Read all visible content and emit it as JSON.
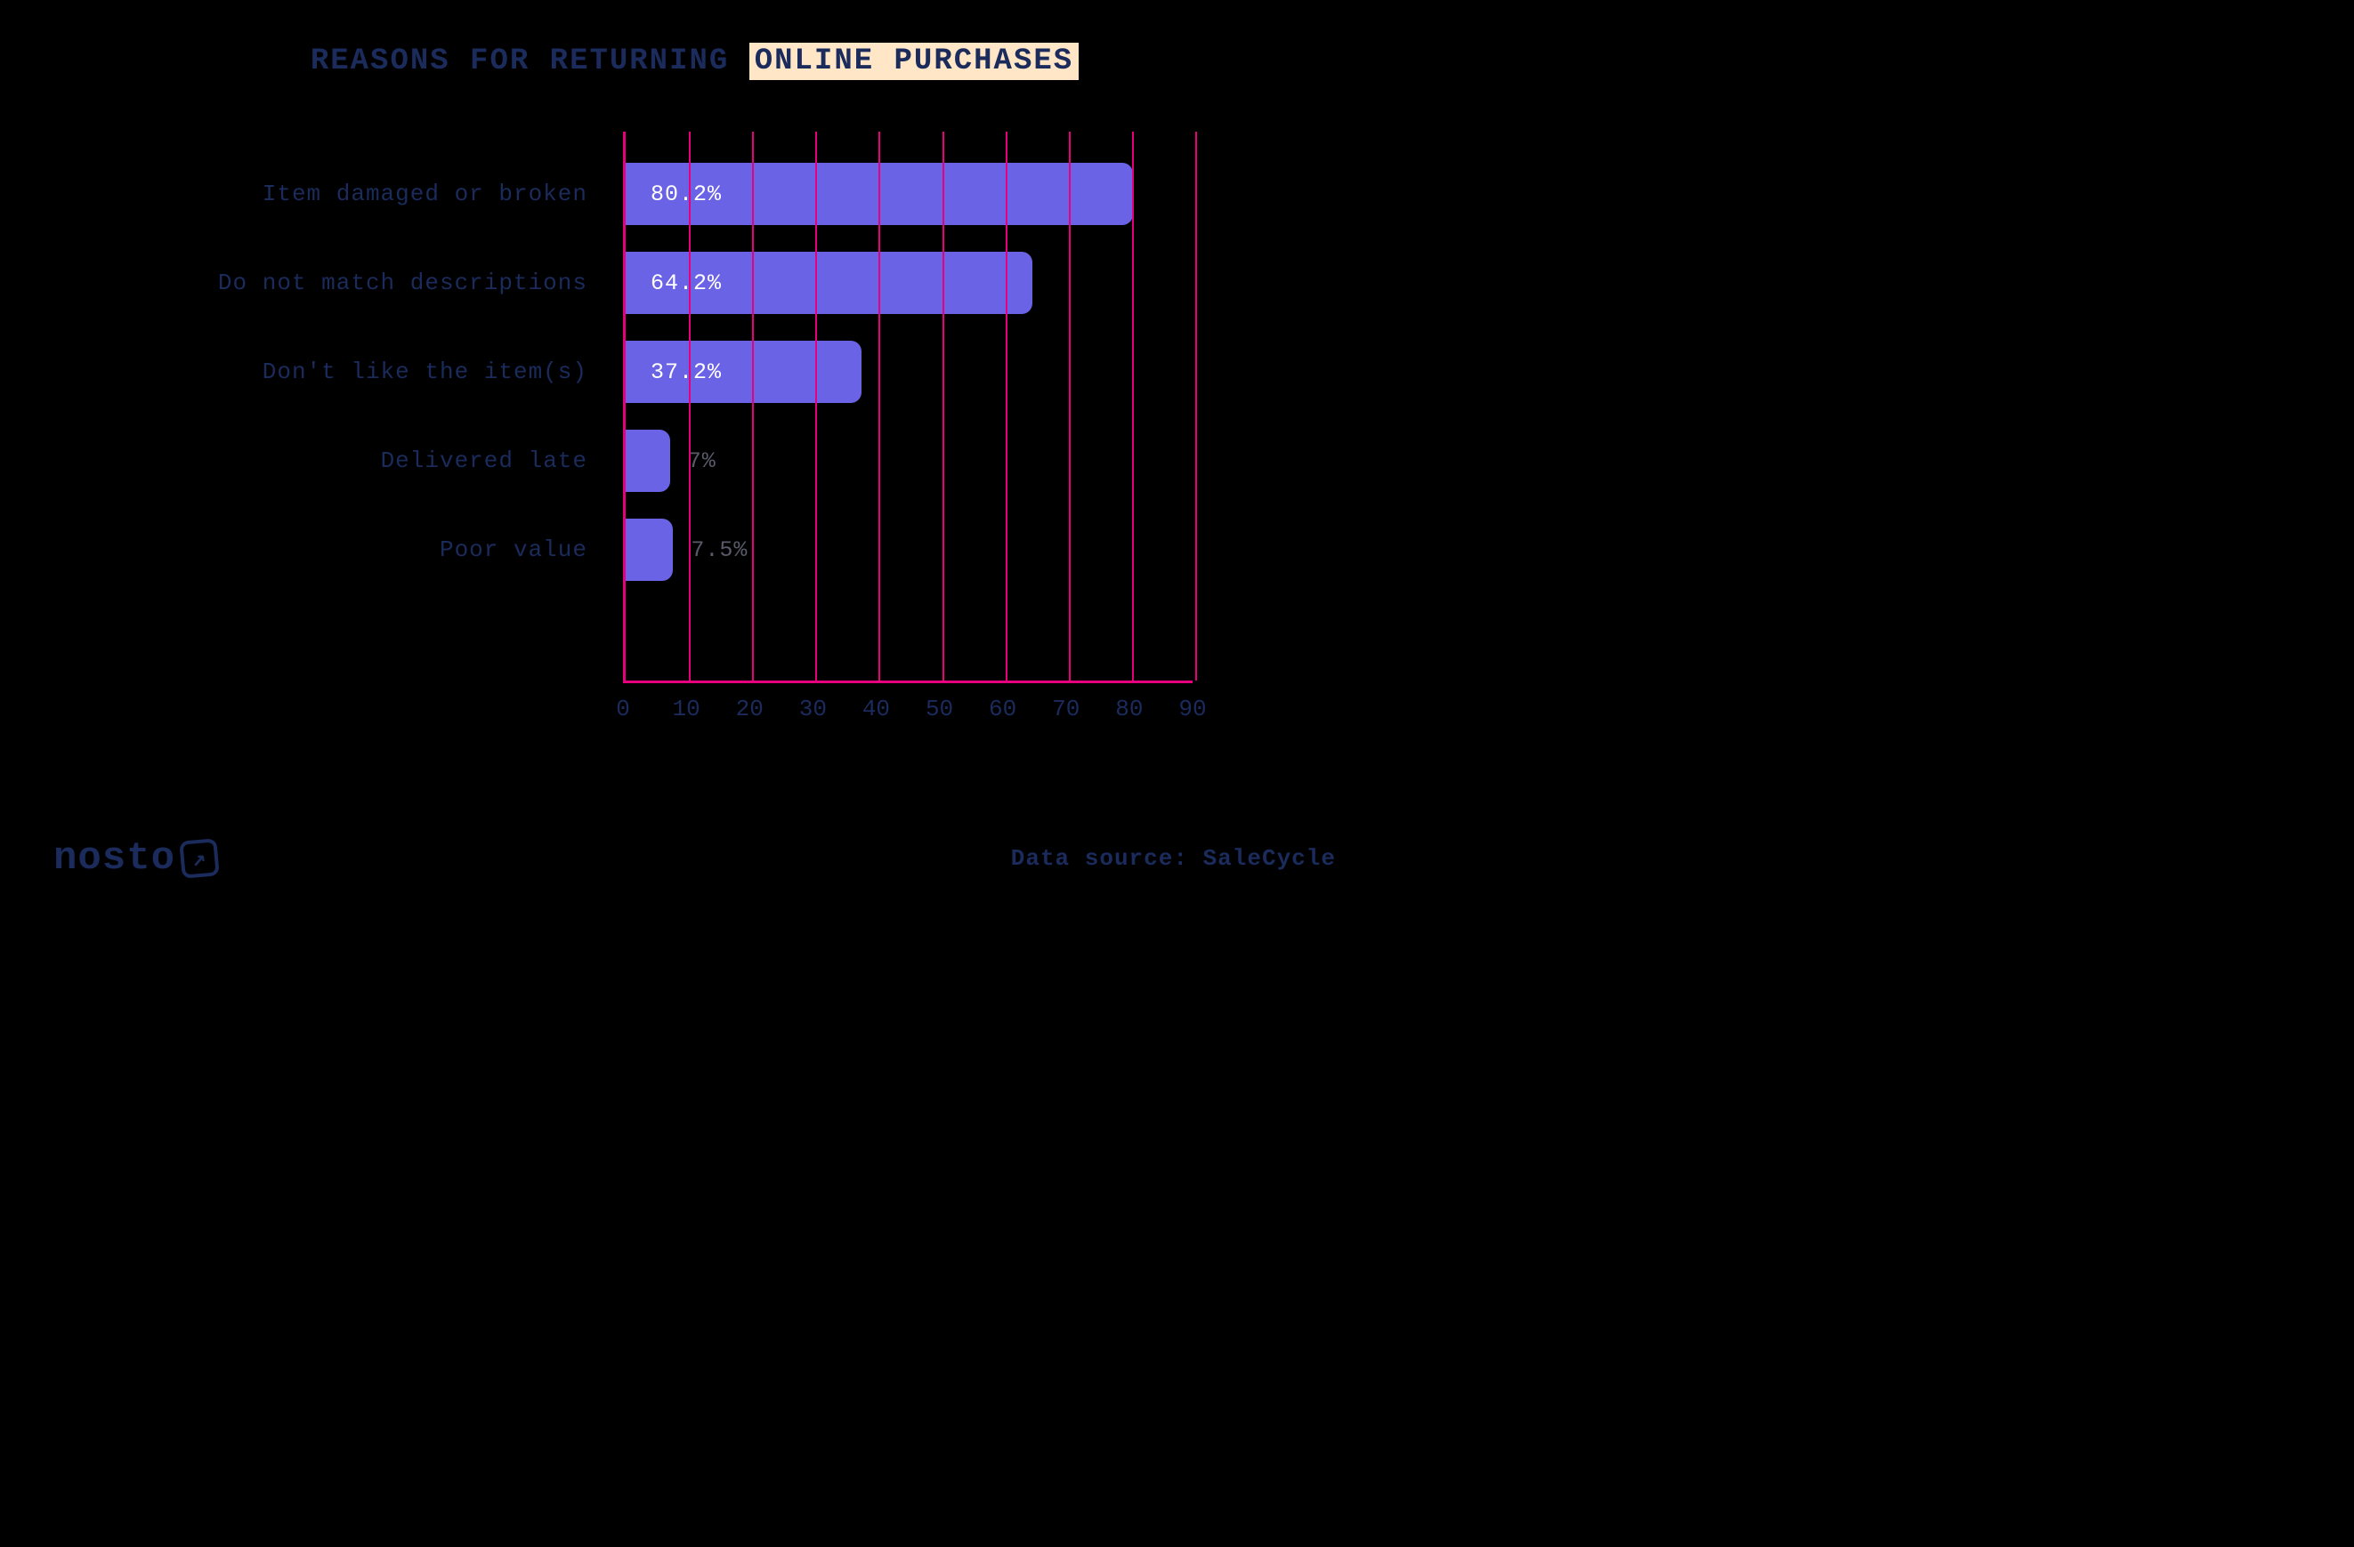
{
  "title": {
    "plain": "REASONS FOR RETURNING ",
    "highlight": "ONLINE PURCHASES"
  },
  "chart_data": {
    "type": "bar",
    "orientation": "horizontal",
    "title": "REASONS FOR RETURNING ONLINE PURCHASES",
    "xlabel": "",
    "ylabel": "",
    "xlim": [
      0,
      90
    ],
    "x_ticks": [
      0,
      10,
      20,
      30,
      40,
      50,
      60,
      70,
      80,
      90
    ],
    "categories": [
      "Item damaged or broken",
      "Do not match descriptions",
      "Don't like the item(s)",
      "Delivered late",
      "Poor value"
    ],
    "values": [
      80.2,
      64.2,
      37.2,
      7,
      7.5
    ],
    "value_labels": [
      "80.2%",
      "64.2%",
      "37.2%",
      "7%",
      "7.5%"
    ],
    "bar_color": "#6a63e6",
    "grid_color": "#e6007e"
  },
  "logo_text": "nosto",
  "source_text": "Data source: SaleCycle"
}
